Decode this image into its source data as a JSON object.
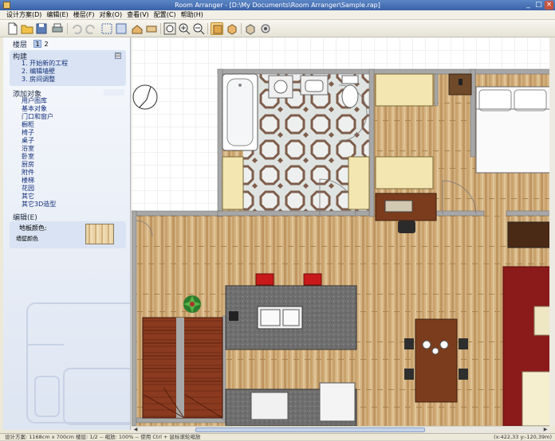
{
  "window": {
    "title": "Room Arranger - [D:\\My Documents\\Room Arranger\\Sample.rap]",
    "controls": {
      "minimize": "_",
      "maximize": "□",
      "close": "×"
    }
  },
  "menu": [
    "设计方案(D)",
    "编辑(E)",
    "楼层(F)",
    "对象(O)",
    "查看(V)",
    "配置(C)",
    "帮助(H)"
  ],
  "toolbar": {
    "buttons": [
      {
        "name": "new-file-icon"
      },
      {
        "name": "open-folder-icon"
      },
      {
        "name": "save-icon"
      },
      {
        "name": "print-icon"
      },
      {
        "name": "undo-icon"
      },
      {
        "name": "redo-icon"
      },
      {
        "name": "select-icon"
      },
      {
        "name": "select-all-icon"
      },
      {
        "name": "room-icon"
      },
      {
        "name": "dimension-icon"
      },
      {
        "name": "zoom-fit-icon"
      },
      {
        "name": "zoom-in-icon"
      },
      {
        "name": "zoom-out-icon"
      },
      {
        "name": "view-2d-icon"
      },
      {
        "name": "view-3d-icon"
      },
      {
        "name": "walk-3d-icon"
      },
      {
        "name": "settings-3d-icon"
      }
    ],
    "active_button": "view-2d-icon"
  },
  "left_panel": {
    "floor_label": "楼层",
    "floors": [
      "1",
      "2"
    ],
    "selected_floor": "1",
    "build_title": "构建",
    "build_items": [
      "1. 开始新的工程",
      "2. 编辑墙壁",
      "3. 房间调整"
    ],
    "collapse_symbol": "⊟",
    "add_objects_title": "添加对象",
    "object_categories": [
      "用户图库",
      "基本对象",
      "门口和窗户",
      "橱柜",
      "椅子",
      "桌子",
      "浴室",
      "卧室",
      "厨房",
      "附件",
      "楼梯",
      "花园",
      "其它",
      "其它3D造型"
    ],
    "edit_title": "编辑(E)",
    "floor_color_label": "地板颜色:",
    "wall_color_label": "墙壁颜色"
  },
  "statusbar": {
    "left": "设计方案: 1168cm x 700cm  楼层: 1/2 -- 缩放: 100% -- 使用 Ctrl + 鼠标滚轮缩放",
    "right": "(x:422,33 y:-120,39m)"
  },
  "colors": {
    "wood_floor": "#d4b383",
    "wall": "#a7a7a7",
    "tile_frame": "#7e5d4b",
    "counter": "#6f6f6f",
    "stairs": "#8a3a1f",
    "rug": "#8b1a1a",
    "cabinet": "#f3e6b1",
    "grid": "#e3e3e3"
  }
}
